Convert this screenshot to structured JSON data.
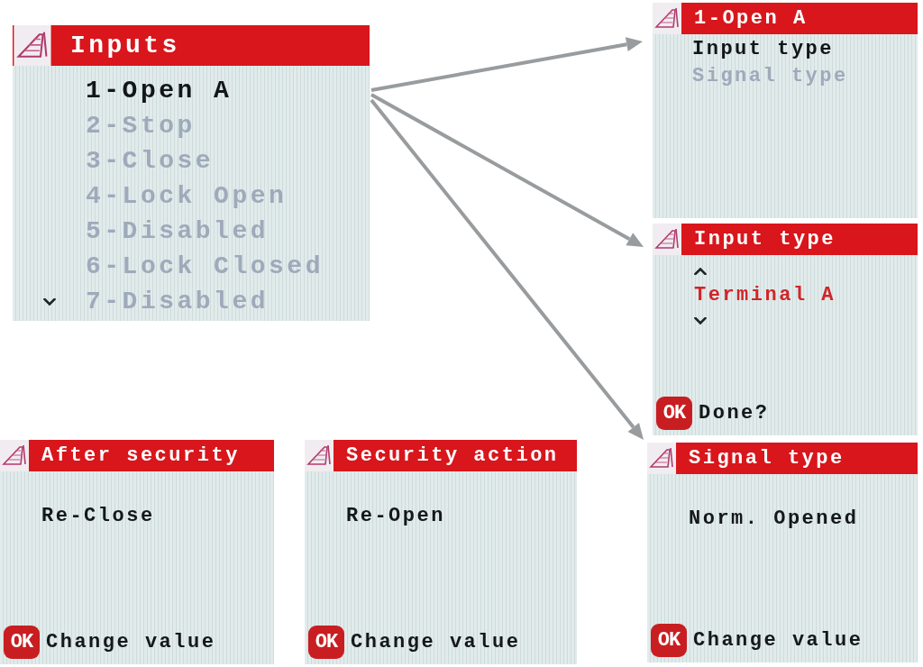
{
  "screens": [
    {
      "kind": "menu",
      "title": "Inputs",
      "items": [
        {
          "label": "1-Open A",
          "selected": true
        },
        {
          "label": "2-Stop",
          "selected": false
        },
        {
          "label": "3-Close",
          "selected": false
        },
        {
          "label": "4-Lock Open",
          "selected": false
        },
        {
          "label": "5-Disabled",
          "selected": false
        },
        {
          "label": "6-Lock Closed",
          "selected": false
        },
        {
          "label": "7-Disabled",
          "selected": false
        }
      ],
      "more_below": true
    },
    {
      "kind": "menu",
      "title": "1-Open A",
      "items": [
        {
          "label": "Input type",
          "selected": true
        },
        {
          "label": "Signal type",
          "selected": false
        }
      ]
    },
    {
      "kind": "picker",
      "title": "Input type",
      "value": "Terminal A",
      "footer": {
        "key": "OK",
        "label": "Done?"
      }
    },
    {
      "kind": "value",
      "title": "After security",
      "value": "Re-Close",
      "footer": {
        "key": "OK",
        "label": "Change value"
      }
    },
    {
      "kind": "value",
      "title": "Security action",
      "value": "Re-Open",
      "footer": {
        "key": "OK",
        "label": "Change value"
      }
    },
    {
      "kind": "value",
      "title": "Signal type",
      "value": "Norm. Opened",
      "footer": {
        "key": "OK",
        "label": "Change value"
      }
    }
  ]
}
